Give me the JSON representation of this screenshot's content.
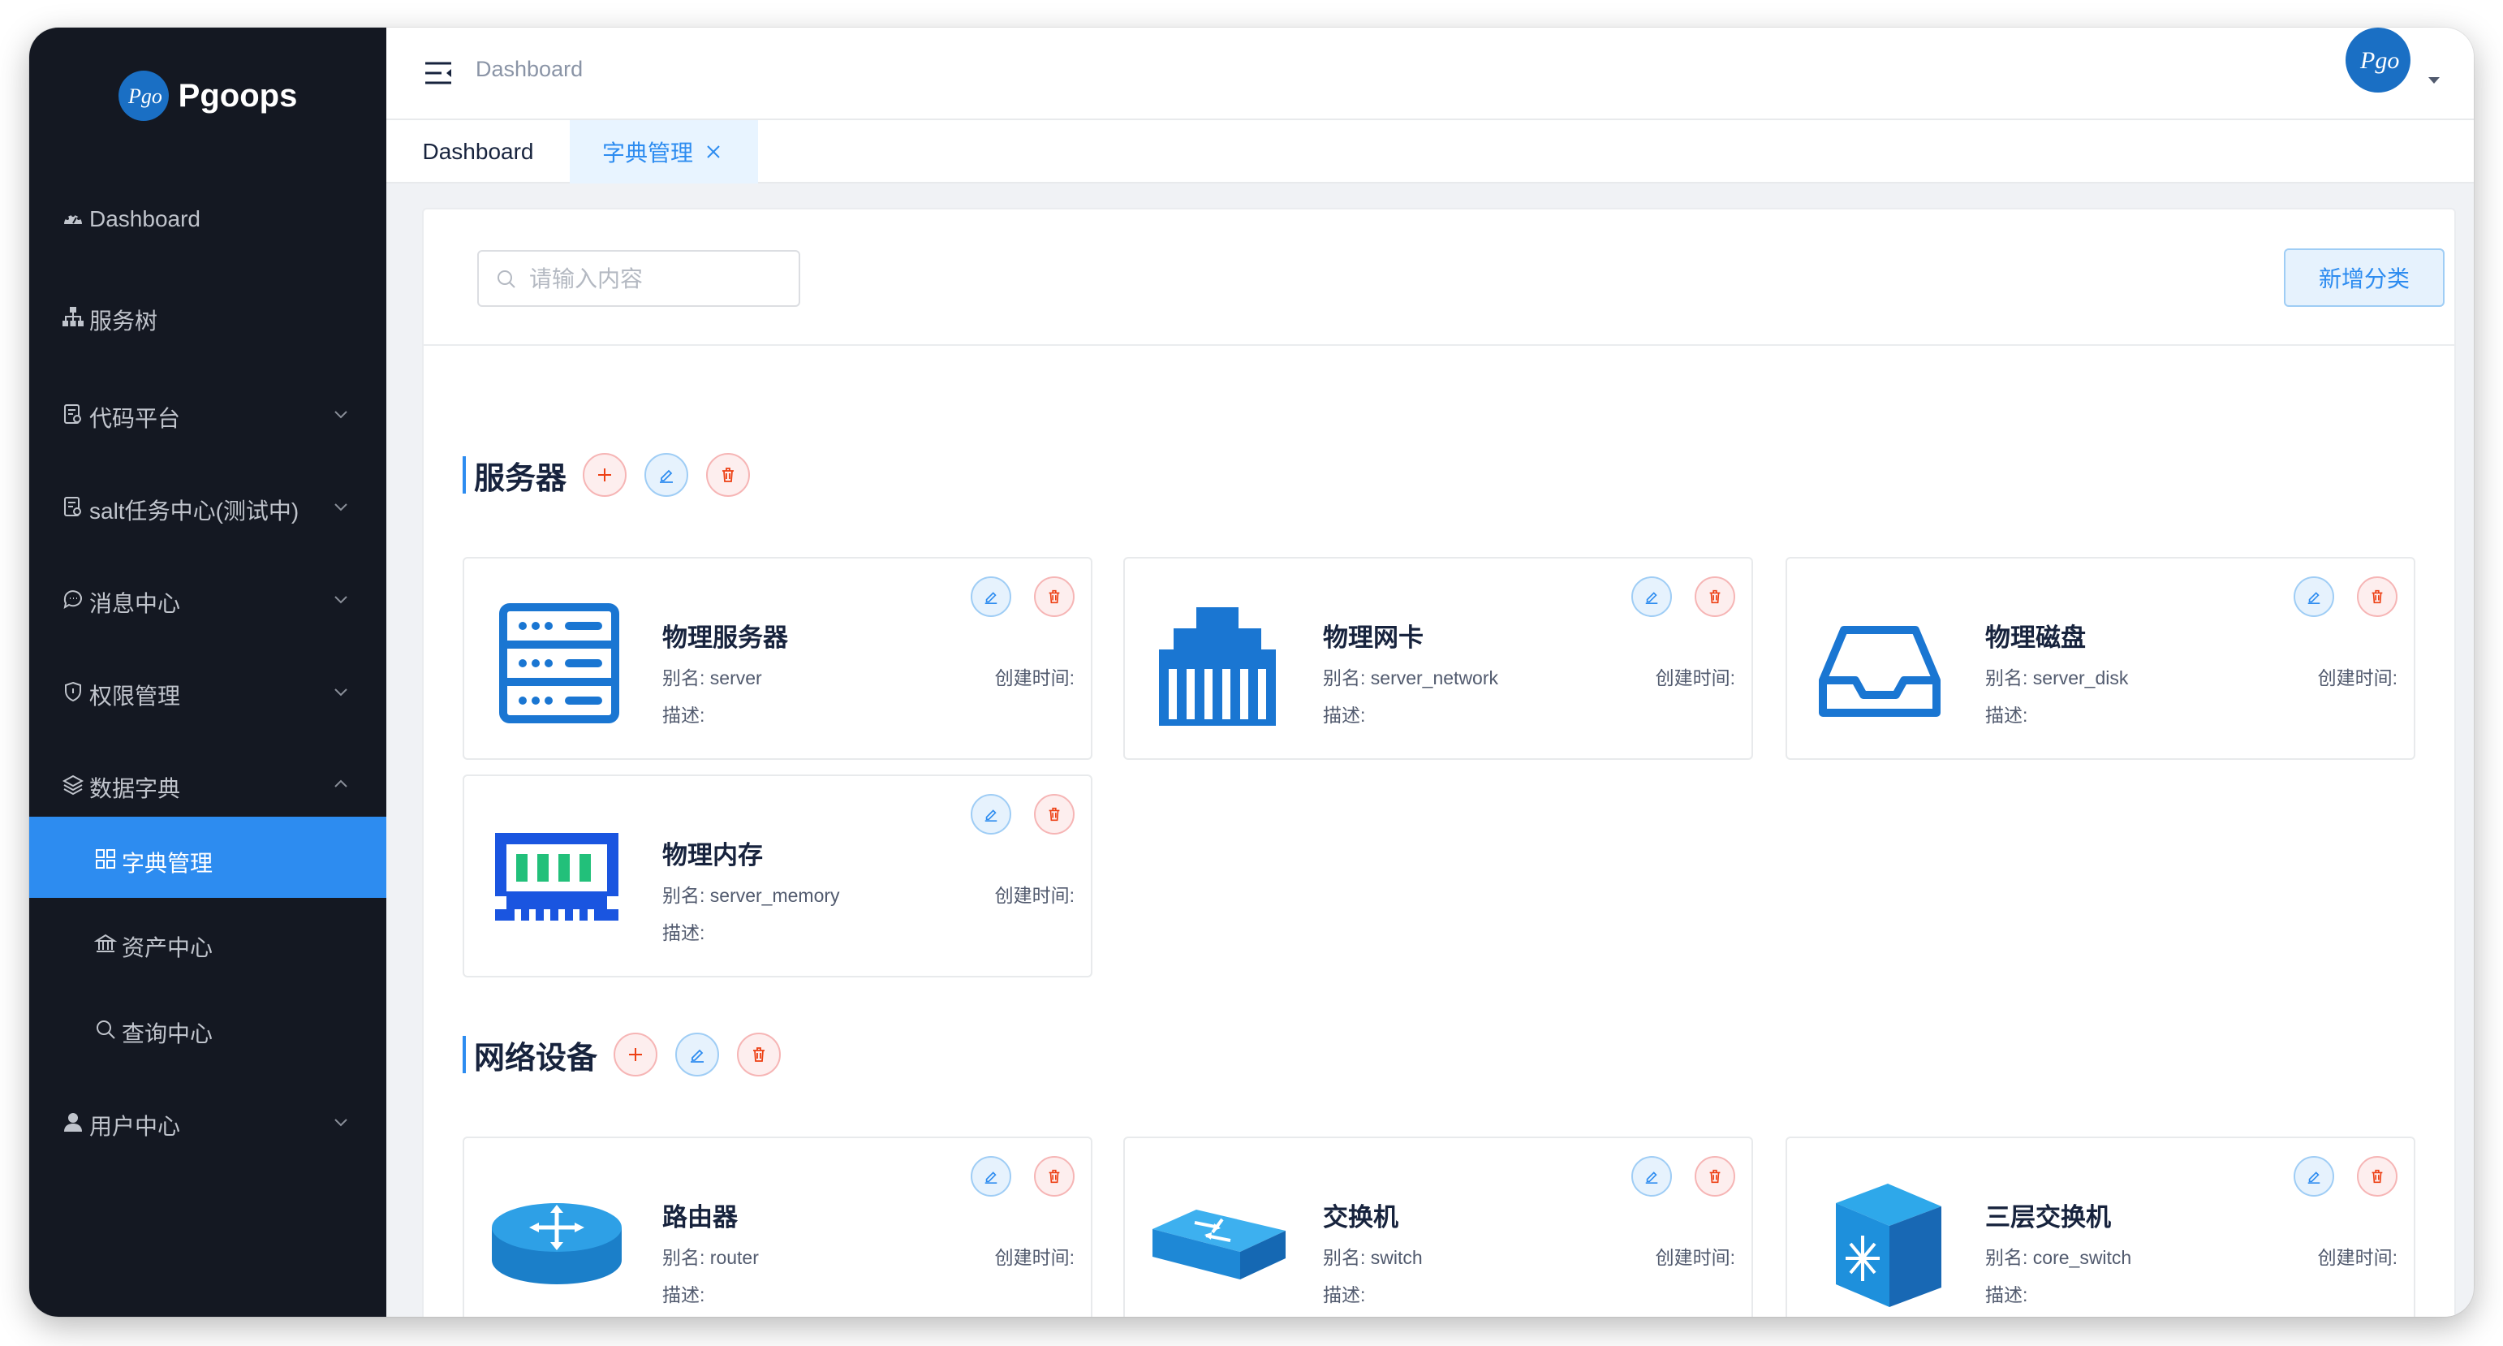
{
  "app": {
    "name": "Pgoops"
  },
  "sidebar": {
    "items": [
      {
        "label": "Dashboard",
        "icon": "dashboard-icon"
      },
      {
        "label": "服务树",
        "icon": "sitemap-icon"
      },
      {
        "label": "代码平台",
        "icon": "document-icon"
      },
      {
        "label": "salt任务中心(测试中)",
        "icon": "document-icon"
      },
      {
        "label": "消息中心",
        "icon": "chat-icon"
      },
      {
        "label": "权限管理",
        "icon": "shield-icon"
      },
      {
        "label": "数据字典",
        "icon": "layers-icon"
      },
      {
        "label": "字典管理",
        "icon": "grid-icon"
      },
      {
        "label": "资产中心",
        "icon": "bank-icon"
      },
      {
        "label": "查询中心",
        "icon": "search-icon"
      },
      {
        "label": "用户中心",
        "icon": "user-icon"
      }
    ]
  },
  "header": {
    "breadcrumb": "Dashboard"
  },
  "tabs": [
    {
      "label": "Dashboard"
    },
    {
      "label": "字典管理"
    }
  ],
  "toolbar": {
    "search_placeholder": "请输入内容",
    "add_category_label": "新增分类"
  },
  "labels": {
    "alias_prefix": "别名: ",
    "desc_label": "描述:",
    "created_label": "创建时间:"
  },
  "sections": [
    {
      "title": "服务器",
      "cards": [
        {
          "name": "物理服务器",
          "alias": "别名: server"
        },
        {
          "name": "物理网卡",
          "alias": "别名: server_network"
        },
        {
          "name": "物理磁盘",
          "alias": "别名: server_disk"
        },
        {
          "name": "物理内存",
          "alias": "别名: server_memory"
        }
      ]
    },
    {
      "title": "网络设备",
      "cards": [
        {
          "name": "路由器",
          "alias": "别名: router"
        },
        {
          "name": "交换机",
          "alias": "别名: switch"
        },
        {
          "name": "三层交换机",
          "alias": "别名: core_switch"
        }
      ]
    }
  ],
  "colors": {
    "sidebar_bg": "#141822",
    "accent": "#2d8cf0",
    "danger": "#ed4014",
    "icon_blue": "#1a76d2"
  }
}
